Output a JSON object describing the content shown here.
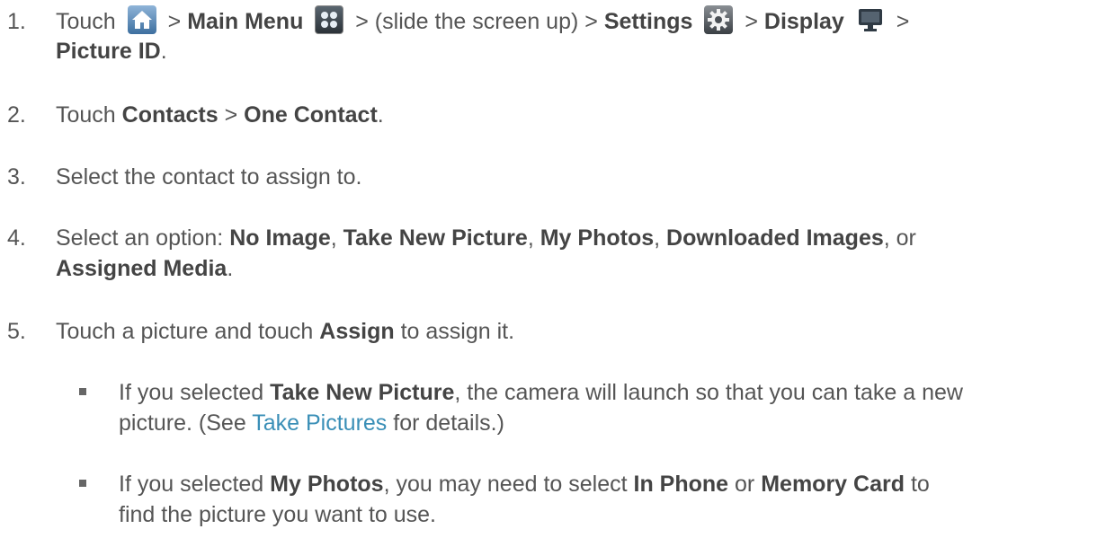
{
  "steps": [
    {
      "num": "1.",
      "touch": "Touch",
      "sep": ">",
      "main_menu": "Main Menu",
      "slide": "> (slide the screen up) >",
      "settings": "Settings",
      "display": "Display",
      "picture_id": "Picture ID",
      "period": "."
    },
    {
      "num": "2.",
      "touch": "Touch",
      "contacts": "Contacts",
      "sep": ">",
      "one_contact": "One Contact",
      "period": "."
    },
    {
      "num": "3.",
      "text": "Select the contact to assign to."
    },
    {
      "num": "4.",
      "text": "Select an option:",
      "no_image": "No Image",
      "take_new": "Take New Picture",
      "my_photos": "My Photos",
      "downloaded": "Downloaded Images",
      "or": ", or",
      "assigned_media": "Assigned Media",
      "comma": ",",
      "period": "."
    },
    {
      "num": "5.",
      "text_a": "Touch a picture and touch",
      "assign": "Assign",
      "text_b": "to assign it."
    }
  ],
  "bullets": [
    {
      "pre": "If you selected",
      "bold": "Take New Picture",
      "line1_rest": ", the camera will launch so that you can take a new",
      "line2_pre": "picture. (See",
      "link": "Take Pictures",
      "line2_post": "for details.)"
    },
    {
      "pre": "If you selected",
      "bold": "My Photos",
      "mid": ", you may need to select",
      "in_phone": "In Phone",
      "or": "or",
      "memory_card": "Memory Card",
      "line1_end": "to",
      "line2": "find the picture you want to use."
    }
  ],
  "icons": {
    "home": "home-icon",
    "main_menu": "main-menu-icon",
    "settings": "gear-icon",
    "display": "monitor-icon"
  }
}
